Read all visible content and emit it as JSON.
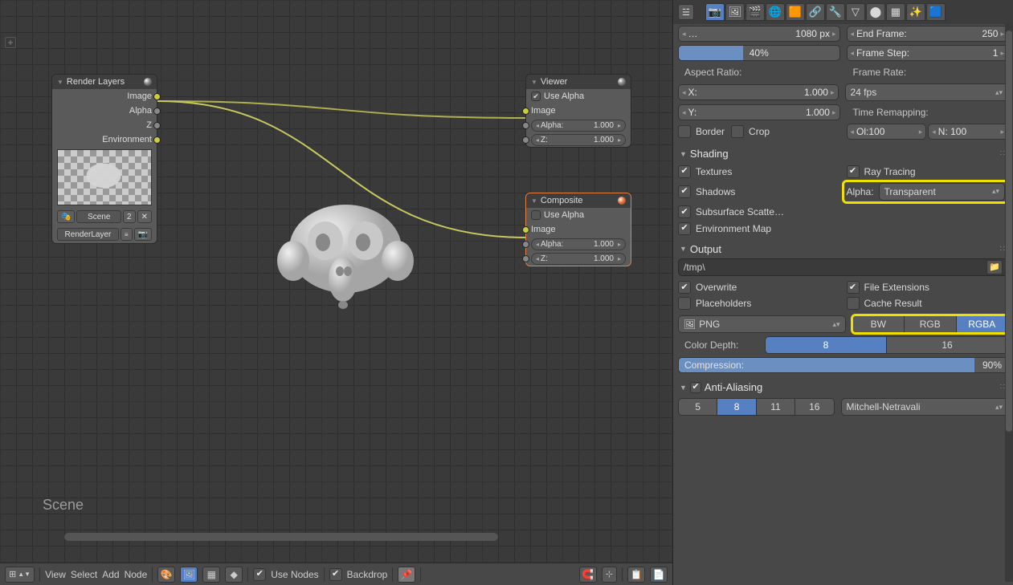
{
  "nodeEditor": {
    "sceneLabel": "Scene",
    "bottomBar": {
      "view": "View",
      "select": "Select",
      "add": "Add",
      "node": "Node",
      "useNodes": "Use Nodes",
      "backdrop": "Backdrop"
    },
    "nodes": {
      "renderLayers": {
        "title": "Render Layers",
        "outImage": "Image",
        "outAlpha": "Alpha",
        "outZ": "Z",
        "outEnv": "Environment",
        "sceneField": "Scene",
        "sceneUsers": "2",
        "layerField": "RenderLayer"
      },
      "viewer": {
        "title": "Viewer",
        "useAlpha": "Use Alpha",
        "inImage": "Image",
        "alphaLabel": "Alpha:",
        "alphaValue": "1.000",
        "zLabel": "Z:",
        "zValue": "1.000"
      },
      "composite": {
        "title": "Composite",
        "useAlpha": "Use Alpha",
        "inImage": "Image",
        "alphaLabel": "Alpha:",
        "alphaValue": "1.000",
        "zLabel": "Z:",
        "zValue": "1.000"
      }
    }
  },
  "properties": {
    "dimensions": {
      "resPx": "1080 px",
      "resPct": "40%",
      "endFrame": "End Frame:",
      "endFrameVal": "250",
      "frameStep": "Frame Step:",
      "frameStepVal": "1",
      "aspect": "Aspect Ratio:",
      "x": "X:",
      "xVal": "1.000",
      "y": "Y:",
      "yVal": "1.000",
      "border": "Border",
      "crop": "Crop",
      "frameRate": "Frame Rate:",
      "fps": "24 fps",
      "timeRemap": "Time Remapping:",
      "old": "Ol:100",
      "new": "N: 100"
    },
    "shading": {
      "title": "Shading",
      "textures": "Textures",
      "shadows": "Shadows",
      "sss": "Subsurface Scatte…",
      "envmap": "Environment Map",
      "raytracing": "Ray Tracing",
      "alphaLabel": "Alpha:",
      "alphaValue": "Transparent"
    },
    "output": {
      "title": "Output",
      "path": "/tmp\\",
      "overwrite": "Overwrite",
      "fileExt": "File Extensions",
      "placeholders": "Placeholders",
      "cacheResult": "Cache Result",
      "format": "PNG",
      "bw": "BW",
      "rgb": "RGB",
      "rgba": "RGBA",
      "colorDepth": "Color Depth:",
      "depth8": "8",
      "depth16": "16",
      "compression": "Compression:",
      "compVal": "90%"
    },
    "aa": {
      "title": "Anti-Aliasing",
      "s5": "5",
      "s8": "8",
      "s11": "11",
      "s16": "16",
      "filter": "Mitchell-Netravali"
    }
  }
}
